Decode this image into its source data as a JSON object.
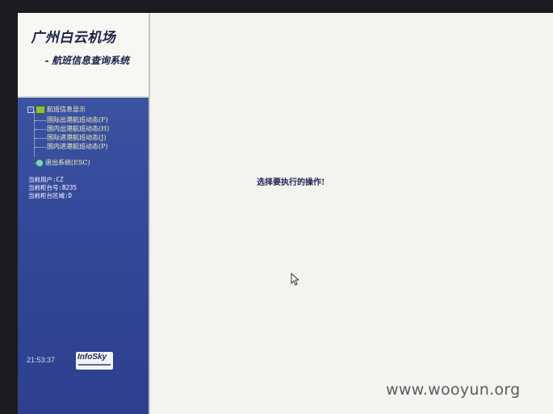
{
  "header": {
    "title": "广州白云机场",
    "subtitle": "- 航班信息查询系统"
  },
  "tree": {
    "root_label": "航班信息显示",
    "root_toggle": "-",
    "items": [
      {
        "label": "国际出港航班动态(F)"
      },
      {
        "label": "国内出港航班动态(H)"
      },
      {
        "label": "国际进港航班动态(J)"
      },
      {
        "label": "国内进港航班动态(P)"
      }
    ],
    "exit_label": "退出系统(ESC)"
  },
  "user_info": {
    "user": "当前用户:CZ",
    "counter": "当前柜台号:B235",
    "area": "当前柜台区域:D"
  },
  "footer": {
    "clock": "21:53:37",
    "logo": "InfoSky"
  },
  "main": {
    "prompt": "选择要执行的操作!"
  },
  "watermark": "www.wooyun.org",
  "colors": {
    "sidebar": "#3f5aa6",
    "header_bg": "#f7f7f4",
    "tree_text": "#f7f0b8",
    "title_text": "#1b2147",
    "content_bg": "#f3f3f0"
  }
}
